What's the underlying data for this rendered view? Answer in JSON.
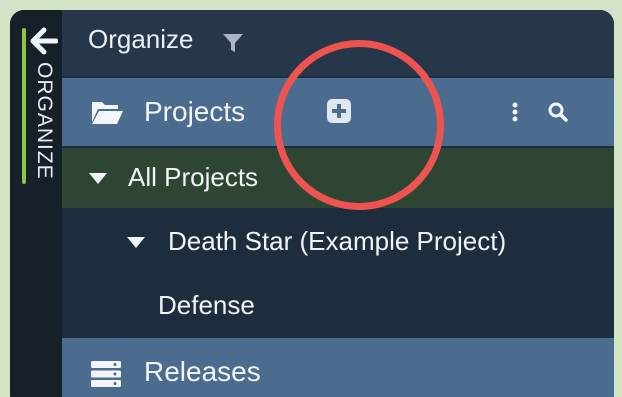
{
  "colors": {
    "page_background": "#d3e3c6",
    "rail": "#162029",
    "rail_accent": "#8cc63f",
    "header": "#253749",
    "section_row": "#4b6c8f",
    "selected_row": "#2f4533",
    "tree_row": "#1e2d3d",
    "annotation_circle": "#ef5350"
  },
  "rail": {
    "back_icon": "arrow-left-icon",
    "label": "ORGANIZE"
  },
  "header": {
    "title": "Organize",
    "filter_icon": "filter-icon"
  },
  "projects_section": {
    "icon": "folder-open-icon",
    "label": "Projects",
    "add_icon": "plus-square-icon",
    "menu_icon": "kebab-icon",
    "search_icon": "search-icon"
  },
  "tree": {
    "all_projects": {
      "label": "All Projects",
      "expanded": true
    },
    "project": {
      "label": "Death Star (Example Project)",
      "expanded": true
    },
    "child": {
      "label": "Defense"
    }
  },
  "releases_section": {
    "icon": "server-stack-icon",
    "label": "Releases"
  },
  "annotation": {
    "shape": "circle",
    "target": "add-project-button"
  }
}
